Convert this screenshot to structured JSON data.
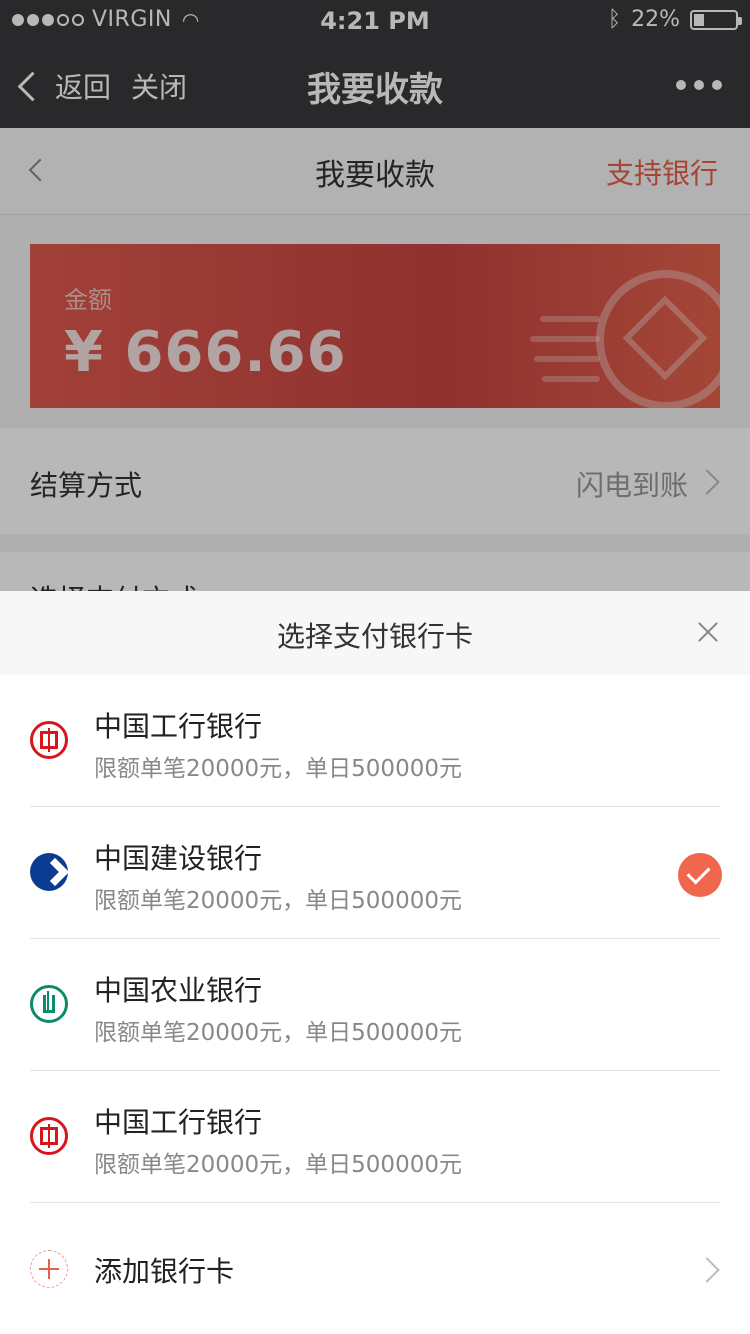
{
  "status_bar": {
    "carrier": "VIRGIN",
    "time": "4:21 PM",
    "battery": "22%",
    "battery_level": 0.22
  },
  "nav": {
    "back_label": "返回",
    "close_label": "关闭",
    "title": "我要收款"
  },
  "page": {
    "subheader_title": "我要收款",
    "support_banks_link": "支持银行",
    "amount_label": "金额",
    "amount_value": "¥ 666.66",
    "settle_label": "结算方式",
    "settle_value": "闪电到账",
    "pay_method_label": "选择支付方式"
  },
  "sheet": {
    "title": "选择支付银行卡",
    "banks": [
      {
        "name": "中国工行银行",
        "limit": "限额单笔20000元，单日500000元",
        "icon": "icbc-logo-icon",
        "selected": false
      },
      {
        "name": "中国建设银行",
        "limit": "限额单笔20000元，单日500000元",
        "icon": "ccb-logo-icon",
        "selected": true
      },
      {
        "name": "中国农业银行",
        "limit": "限额单笔20000元，单日500000元",
        "icon": "abc-logo-icon",
        "selected": false
      },
      {
        "name": "中国工行银行",
        "limit": "限额单笔20000元，单日500000元",
        "icon": "icbc-logo-icon",
        "selected": false
      }
    ],
    "add_card_label": "添加银行卡"
  },
  "colors": {
    "accent": "#f0674e",
    "card_red": "#d94f49",
    "nav_bg": "#3a3a3c"
  }
}
